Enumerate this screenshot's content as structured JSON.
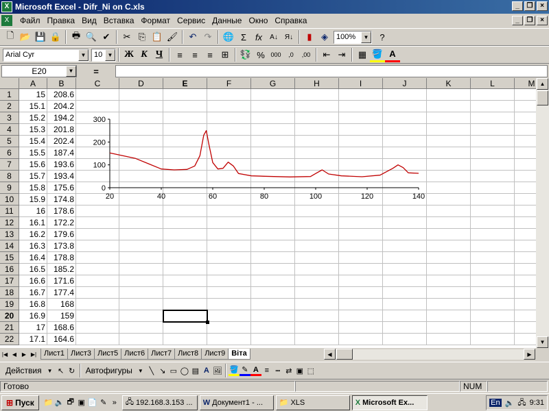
{
  "window": {
    "title": "Microsoft Excel - Difr_Ni on C.xls"
  },
  "menu": [
    "Файл",
    "Правка",
    "Вид",
    "Вставка",
    "Формат",
    "Сервис",
    "Данные",
    "Окно",
    "Справка"
  ],
  "toolbar": {
    "zoom": "100%"
  },
  "format": {
    "font": "Arial Cyr",
    "size": "10",
    "bold": "Ж",
    "italic": "К",
    "underline": "Ч"
  },
  "formula": {
    "cell_ref": "E20",
    "equals": "=",
    "value": ""
  },
  "columns": [
    "A",
    "B",
    "C",
    "D",
    "E",
    "F",
    "G",
    "H",
    "I",
    "J",
    "K",
    "L",
    "M"
  ],
  "rows": [
    {
      "n": "1",
      "a": "15",
      "b": "208.6"
    },
    {
      "n": "2",
      "a": "15.1",
      "b": "204.2"
    },
    {
      "n": "3",
      "a": "15.2",
      "b": "194.2"
    },
    {
      "n": "4",
      "a": "15.3",
      "b": "201.8"
    },
    {
      "n": "5",
      "a": "15.4",
      "b": "202.4"
    },
    {
      "n": "6",
      "a": "15.5",
      "b": "187.4"
    },
    {
      "n": "7",
      "a": "15.6",
      "b": "193.6"
    },
    {
      "n": "8",
      "a": "15.7",
      "b": "193.4"
    },
    {
      "n": "9",
      "a": "15.8",
      "b": "175.6"
    },
    {
      "n": "10",
      "a": "15.9",
      "b": "174.8"
    },
    {
      "n": "11",
      "a": "16",
      "b": "178.6"
    },
    {
      "n": "12",
      "a": "16.1",
      "b": "172.2"
    },
    {
      "n": "13",
      "a": "16.2",
      "b": "179.6"
    },
    {
      "n": "14",
      "a": "16.3",
      "b": "173.8"
    },
    {
      "n": "15",
      "a": "16.4",
      "b": "178.8"
    },
    {
      "n": "16",
      "a": "16.5",
      "b": "185.2"
    },
    {
      "n": "17",
      "a": "16.6",
      "b": "171.6"
    },
    {
      "n": "18",
      "a": "16.7",
      "b": "177.4"
    },
    {
      "n": "19",
      "a": "16.8",
      "b": "168"
    },
    {
      "n": "20",
      "a": "16.9",
      "b": "159"
    },
    {
      "n": "21",
      "a": "17",
      "b": "168.6"
    },
    {
      "n": "22",
      "a": "17.1",
      "b": "164.6"
    }
  ],
  "embedded_chart": {
    "type": "line",
    "color": "#c00000",
    "xlim": [
      20,
      140
    ],
    "ylim": [
      0,
      300
    ],
    "xticks": [
      "20",
      "40",
      "60",
      "80",
      "100",
      "120",
      "140"
    ],
    "yticks": [
      "0",
      "100",
      "200",
      "300"
    ],
    "x": [
      20,
      30,
      35,
      40,
      45,
      50,
      53,
      55,
      56.5,
      57.5,
      58.5,
      60,
      62,
      64,
      66,
      68,
      70,
      75,
      80,
      90,
      98,
      100,
      102.5,
      105,
      110,
      118,
      125,
      130,
      132,
      134,
      136,
      140
    ],
    "y": [
      152,
      128,
      105,
      82,
      78,
      80,
      95,
      140,
      230,
      250,
      190,
      110,
      82,
      85,
      112,
      95,
      62,
      52,
      50,
      47,
      49,
      62,
      78,
      60,
      52,
      48,
      55,
      85,
      100,
      88,
      65,
      63
    ]
  },
  "sheets": [
    "Лист1",
    "Лист3",
    "Лист5",
    "Лист6",
    "Лист7",
    "Лист8",
    "Лист9",
    "Віта"
  ],
  "active_sheet": "Віта",
  "drawing": {
    "actions": "Действия",
    "autoshapes": "Автофигуры"
  },
  "status": {
    "ready": "Готово",
    "num": "NUM"
  },
  "taskbar": {
    "start": "Пуск",
    "tasks": [
      "192.168.3.153 ...",
      "Документ1 - ...",
      "XLS",
      "Microsoft Ex..."
    ],
    "lang": "En",
    "time": "9:31"
  }
}
